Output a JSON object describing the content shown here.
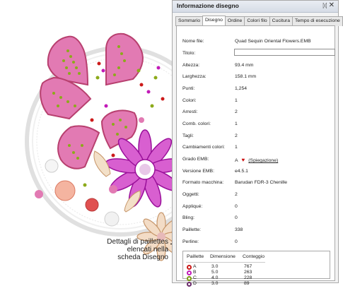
{
  "panel": {
    "title": "Informazione disegno",
    "pin_icon": "pin-icon",
    "close_icon": "close-icon",
    "tabs": [
      "Sommario",
      "Disegno",
      "Ordine",
      "Colori filo",
      "Cucitura",
      "Tempo di esecuzione"
    ],
    "active_tab": "Disegno"
  },
  "fields": [
    {
      "label": "Nome file:",
      "value": "Quad Sequin Oriental Flowers.EMB"
    },
    {
      "label": "Titolo:",
      "value": ""
    },
    {
      "label": "Altezza:",
      "value": "93.4 mm"
    },
    {
      "label": "Larghezza:",
      "value": "158.1 mm"
    },
    {
      "label": "Punti:",
      "value": "1,254"
    },
    {
      "label": "Colori:",
      "value": "1"
    },
    {
      "label": "Arresti:",
      "value": "2"
    },
    {
      "label": "Comb. colori:",
      "value": "1"
    },
    {
      "label": "Tagli:",
      "value": "2"
    },
    {
      "label": "Cambiamenti colori:",
      "value": "1"
    },
    {
      "label": "Grado EMB:",
      "value": "A",
      "link": "(Spiegazione)"
    },
    {
      "label": "Versione EMB:",
      "value": "e4.5.1"
    },
    {
      "label": "Formato macchina:",
      "value": "Barudan FDR-3 Chenille"
    },
    {
      "label": "Oggetti:",
      "value": "2"
    },
    {
      "label": "Appliqué:",
      "value": "0"
    },
    {
      "label": "Bling:",
      "value": "0"
    },
    {
      "label": "Paillette:",
      "value": "338"
    },
    {
      "label": "Perline:",
      "value": "0"
    }
  ],
  "sequins": {
    "headers": [
      "Paillette",
      "Dimensione",
      "Conteggio"
    ],
    "rows": [
      {
        "code": "A",
        "size": "3.0",
        "count": "767",
        "color": "#cc1a1a"
      },
      {
        "code": "B",
        "size": "5.0",
        "count": "263",
        "color": "#c21ab8"
      },
      {
        "code": "C",
        "size": "4.0",
        "count": "228",
        "color": "#7a9a12"
      },
      {
        "code": "D",
        "size": "3.0",
        "count": "89",
        "color": "#6a2a6a"
      }
    ]
  },
  "callout": {
    "line1": "Dettagli di paillettes",
    "line2": "elencati nella",
    "line3": "scheda Disegno"
  },
  "colors": {
    "petal_pink": "#e27ab3",
    "petal_outline": "#b8406f",
    "sequin_green": "#8caa1a",
    "flower_purple": "#b01ab0",
    "heart": "#cc1111"
  }
}
